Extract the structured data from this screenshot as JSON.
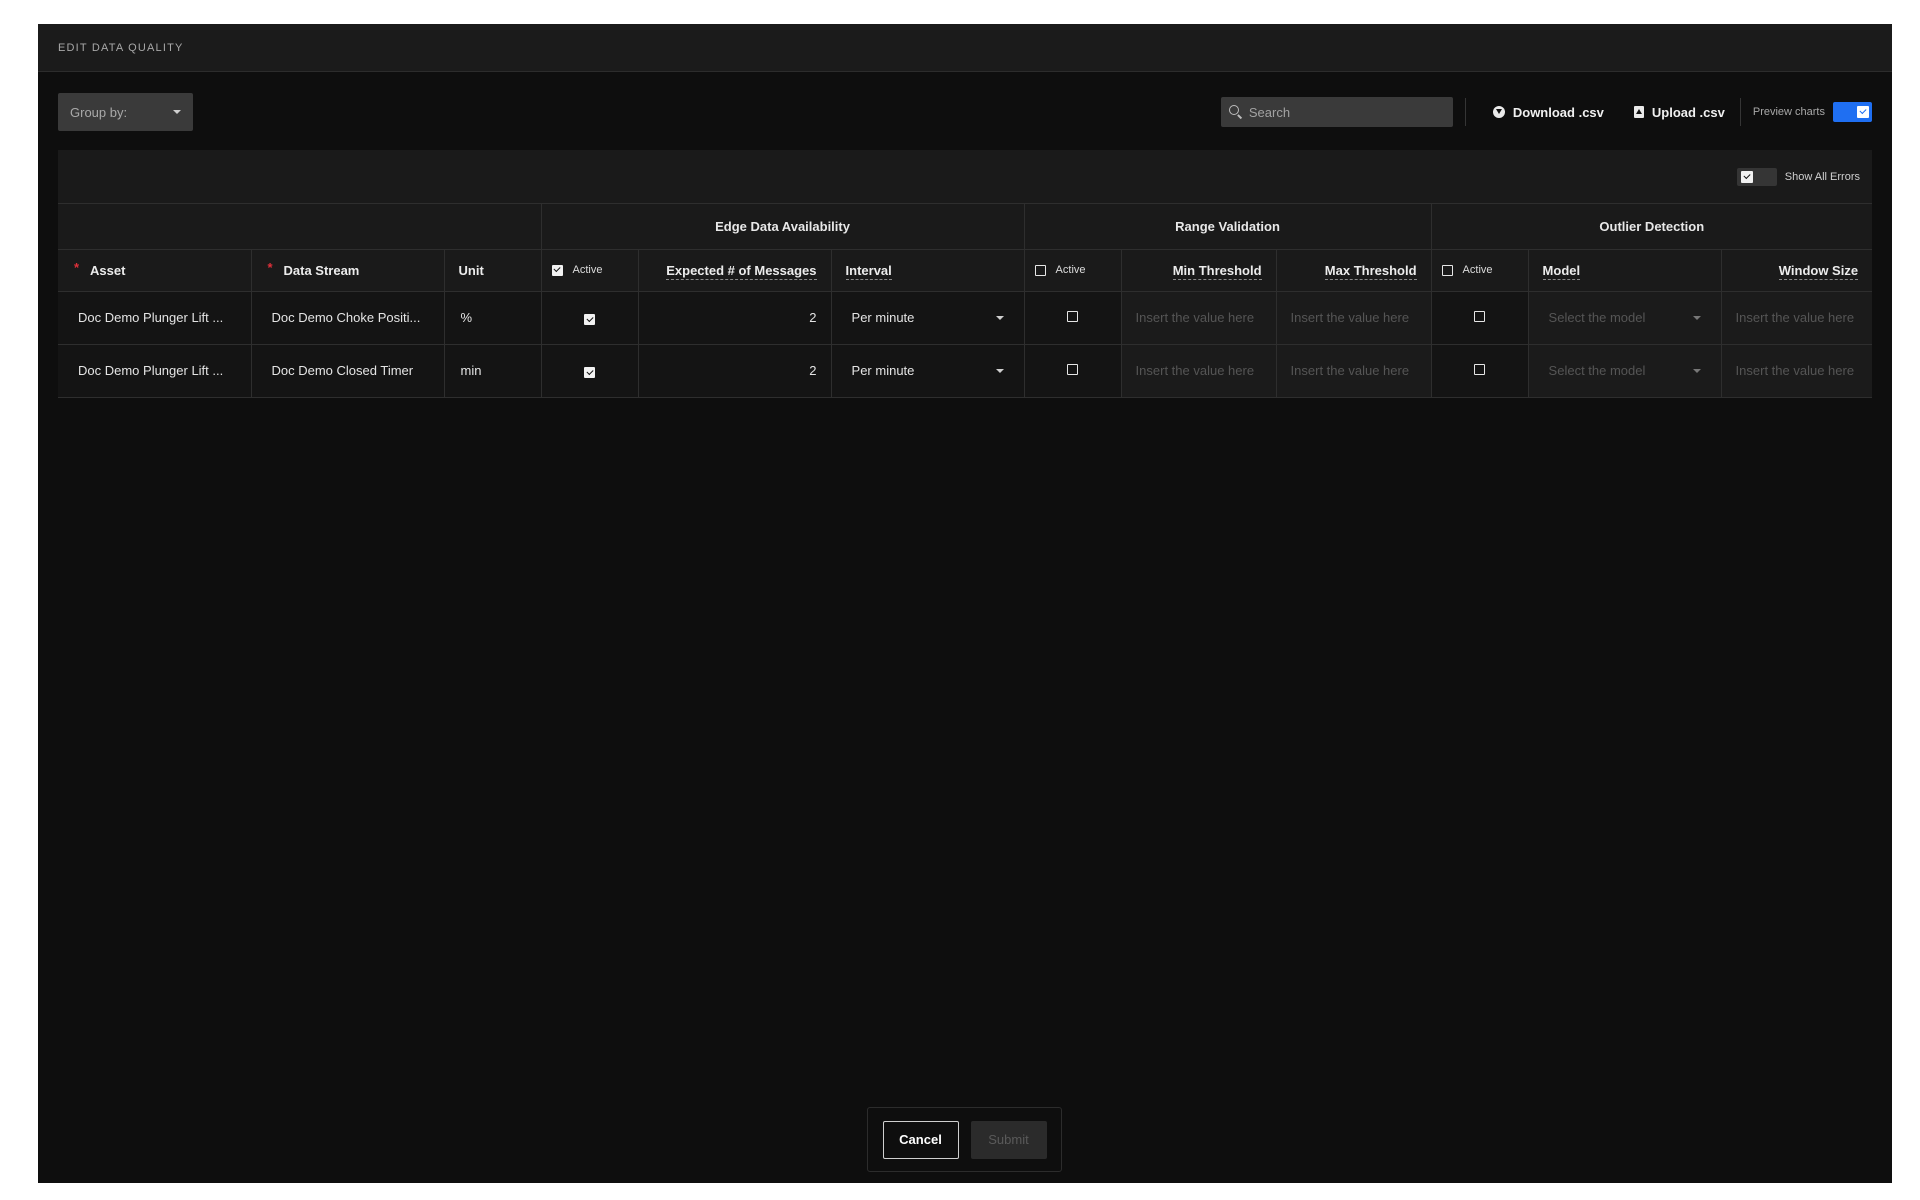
{
  "modal": {
    "title": "EDIT DATA QUALITY"
  },
  "toolbar": {
    "group_by_label": "Group by:",
    "search_placeholder": "Search",
    "download_label": "Download .csv",
    "upload_label": "Upload .csv",
    "preview_label": "Preview charts",
    "preview_on": true
  },
  "table": {
    "show_all_errors_label": "Show All Errors",
    "show_all_errors_on": true,
    "groups": {
      "edge": "Edge Data Availability",
      "range": "Range Validation",
      "outlier": "Outlier Detection"
    },
    "headers": {
      "asset": "Asset",
      "data_stream": "Data Stream",
      "unit": "Unit",
      "active": "Active",
      "expected": "Expected # of Messages",
      "interval": "Interval",
      "min_threshold": "Min Threshold",
      "max_threshold": "Max Threshold",
      "model": "Model",
      "window_size": "Window Size"
    },
    "header_checks": {
      "edge": true,
      "range": false,
      "outlier": false
    },
    "placeholders": {
      "value": "Insert the value here",
      "model": "Select the model"
    },
    "rows": [
      {
        "asset": "Doc Demo Plunger Lift ...",
        "data_stream": "Doc Demo Choke Positi...",
        "unit": "%",
        "edge_active": true,
        "expected": "2",
        "interval": "Per minute",
        "range_active": false,
        "outlier_active": false
      },
      {
        "asset": "Doc Demo Plunger Lift ...",
        "data_stream": "Doc Demo Closed Timer",
        "unit": "min",
        "edge_active": true,
        "expected": "2",
        "interval": "Per minute",
        "range_active": false,
        "outlier_active": false
      }
    ]
  },
  "footer": {
    "cancel_label": "Cancel",
    "submit_label": "Submit"
  }
}
